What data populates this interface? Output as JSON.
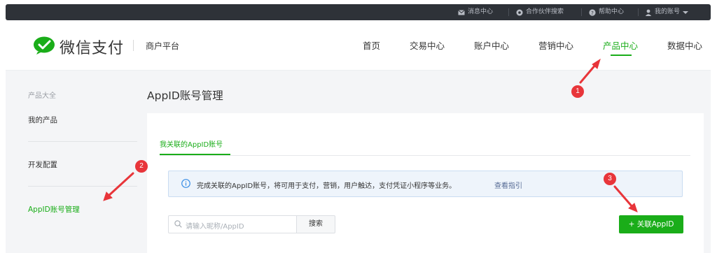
{
  "topbar": {
    "messages": "消息中心",
    "partner_search": "合作伙伴搜索",
    "help": "帮助中心",
    "account": "我的账号"
  },
  "header": {
    "logo_text": "微信支付",
    "platform": "商户平台",
    "nav": [
      "首页",
      "交易中心",
      "账户中心",
      "营销中心",
      "产品中心",
      "数据中心"
    ],
    "active_nav": "产品中心"
  },
  "sidebar": {
    "caption": "产品大全",
    "items": [
      "我的产品",
      "开发配置",
      "AppID账号管理"
    ],
    "active_item": "AppID账号管理"
  },
  "main": {
    "title": "AppID账号管理",
    "tab": "我关联的AppID账号",
    "notice_text": "完成关联的AppID账号，将可用于支付，营销，用户触达，支付凭证小程序等业务。",
    "notice_link": "查看指引",
    "search_placeholder": "请输入昵称/AppID",
    "search_button": "搜索",
    "add_button": "+ 关联AppID"
  },
  "annotations": [
    "1",
    "2",
    "3"
  ],
  "colors": {
    "accent": "#1aad19",
    "topbar": "#2e3238",
    "marker": "#e8353a",
    "link": "#576b95"
  }
}
